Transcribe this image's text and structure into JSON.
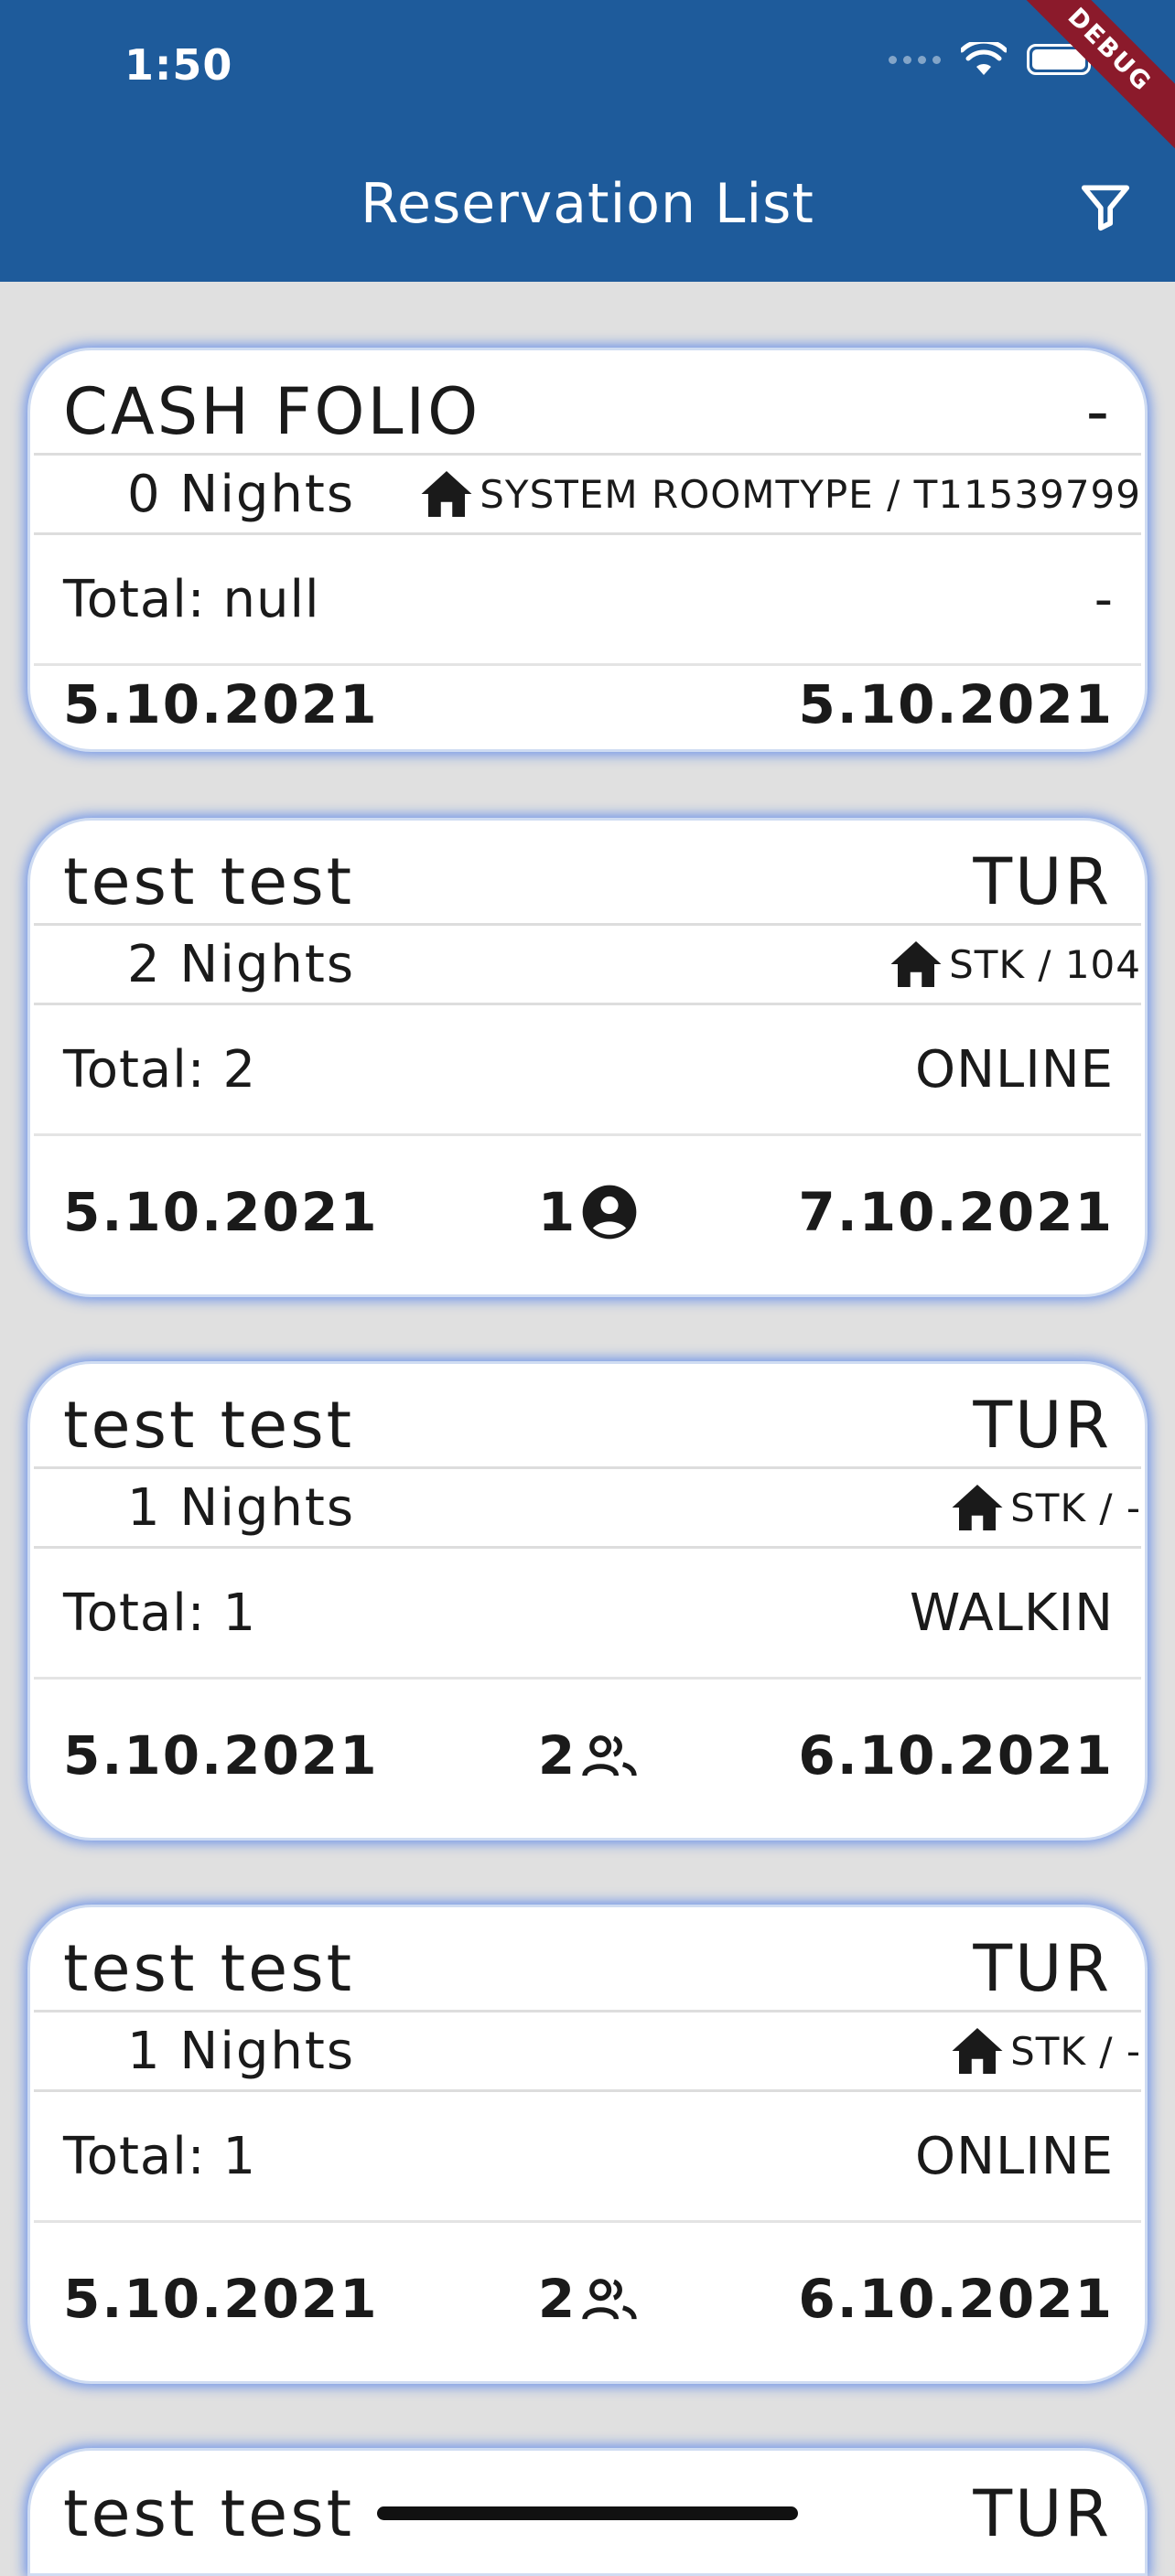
{
  "status_bar": {
    "time": "1:50"
  },
  "debug_banner": "DEBUG",
  "appbar": {
    "title": "Reservation List",
    "filter_icon": "filter-icon"
  },
  "colors": {
    "appbar": "#1e5b9b",
    "background": "#e0e0e0",
    "card_glow": "#4678eb",
    "debug": "#8b1a2b"
  },
  "reservations": [
    {
      "name": "CASH FOLIO",
      "code": "-",
      "nights": "0 Nights",
      "room": "SYSTEM ROOMTYPE / T11539799",
      "total": "Total: null",
      "source": "-",
      "checkin": "5.10.2021",
      "checkout": "5.10.2021"
    },
    {
      "name": "test test",
      "code": "TUR",
      "nights": "2 Nights",
      "room": "STK / 104",
      "total": "Total: 2",
      "source": "ONLINE",
      "checkin": "5.10.2021",
      "guests": "1",
      "guest_icon": "person-icon",
      "checkout": "7.10.2021"
    },
    {
      "name": "test test",
      "code": "TUR",
      "nights": "1 Nights",
      "room": "STK / -",
      "total": "Total: 1",
      "source": "WALKIN",
      "checkin": "5.10.2021",
      "guests": "2",
      "guest_icon": "people-icon",
      "checkout": "6.10.2021"
    },
    {
      "name": "test test",
      "code": "TUR",
      "nights": "1 Nights",
      "room": "STK / -",
      "total": "Total: 1",
      "source": "ONLINE",
      "checkin": "5.10.2021",
      "guests": "2",
      "guest_icon": "people-icon",
      "checkout": "6.10.2021"
    },
    {
      "name": "test test",
      "code": "TUR"
    }
  ]
}
